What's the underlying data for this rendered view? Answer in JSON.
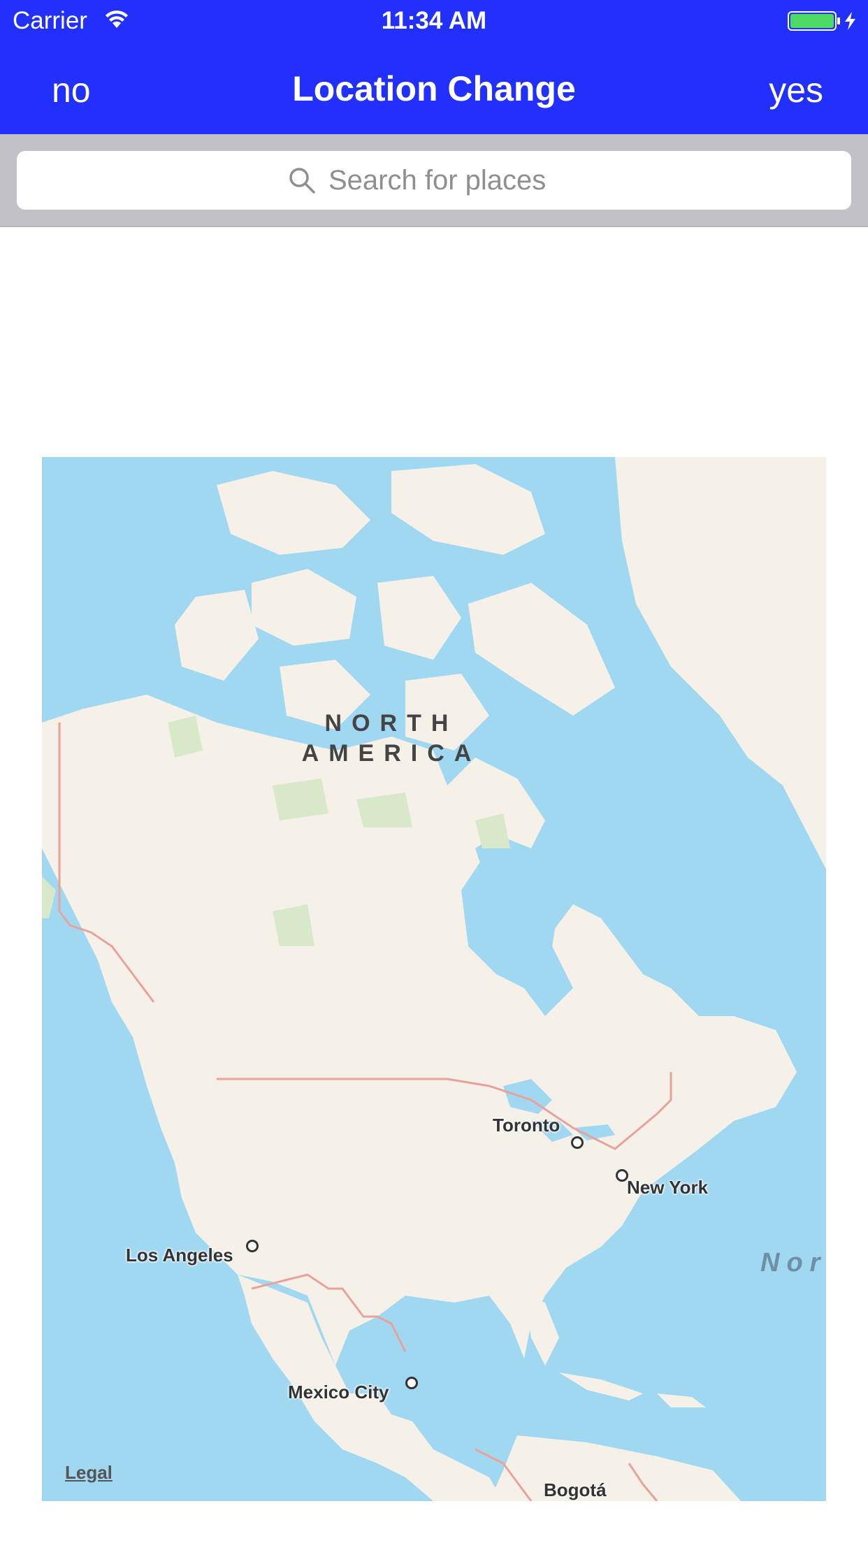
{
  "status_bar": {
    "carrier": "Carrier",
    "time": "11:34 AM",
    "battery_color": "#4cd964"
  },
  "nav": {
    "left_label": "no",
    "title": "Location Change",
    "right_label": "yes",
    "background": "#2130fb"
  },
  "search": {
    "placeholder": "Search for places",
    "value": ""
  },
  "map": {
    "region_label": "NORTH AMERICA",
    "region_line1": "NORTH",
    "region_line2": "AMERICA",
    "ocean_label": "Nor",
    "cities": [
      {
        "name": "Toronto"
      },
      {
        "name": "New York"
      },
      {
        "name": "Los Angeles"
      },
      {
        "name": "Mexico City"
      },
      {
        "name": "Bogotá"
      }
    ],
    "legal_label": "Legal",
    "water_color": "#a1d8f1",
    "land_color": "#f5f1e8",
    "park_color": "#d7e9c8"
  }
}
